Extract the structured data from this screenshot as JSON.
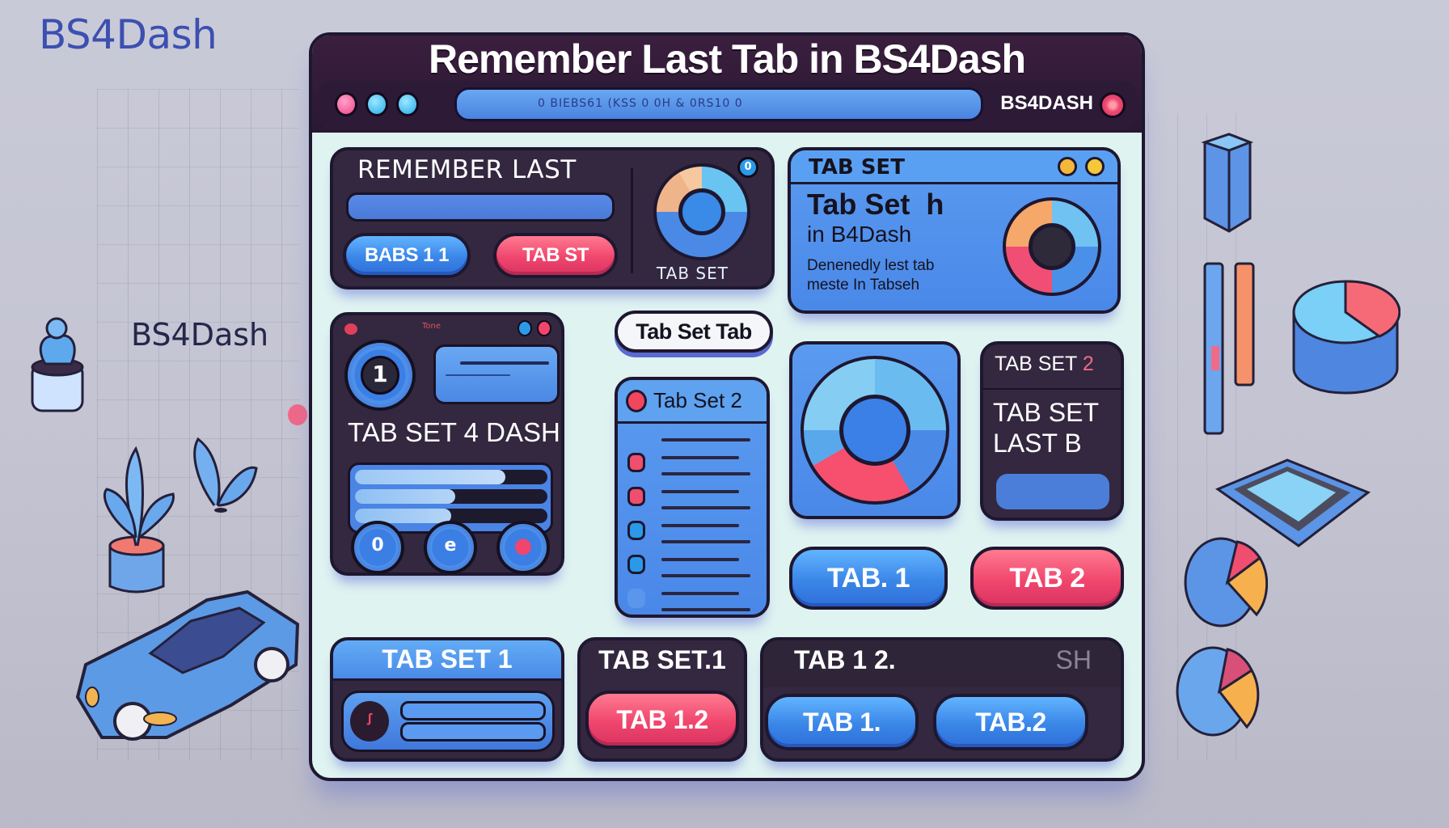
{
  "background": {
    "brand_top": "BS4Dash",
    "brand_side": "BS4Dash"
  },
  "window": {
    "title": "Remember Last Tab in BS4Dash",
    "toolbar": {
      "address_text": "0 BIEBS61 (KSS 0 0H & 0RS10 0",
      "brand": "BS4DASH"
    }
  },
  "cards": {
    "remember_last": {
      "title": "REMEMBER LAST",
      "button_blue": "BABS 1 1",
      "button_red": "TAB ST",
      "donut_label": "TAB SET",
      "badge": "0"
    },
    "tab_set_info": {
      "header": "TAB SET",
      "heading_line1": "Tab Set  h",
      "heading_line2": "in B4Dash",
      "desc_line1": "Denenedly lest tab",
      "desc_line2": "meste In Tabseh"
    },
    "tab_set_dash": {
      "header_text": "Tone",
      "number_badge": "1",
      "title": "TAB SET 4 DASH",
      "progress": [
        0.78,
        0.52,
        0.5
      ],
      "round_buttons": [
        "0",
        "e",
        "●"
      ]
    },
    "tab_set_tab_pill": "Tab Set Tab",
    "tab_set_2_list": {
      "header": "Tab Set 2",
      "items": 6
    },
    "tab_set_2_dark": {
      "header": "TAB SET",
      "header_num": "2",
      "line1": "TAB SET",
      "line2": "LAST B"
    },
    "tab_pills": {
      "tab1": "TAB. 1",
      "tab2": "TAB 2"
    },
    "bottom": {
      "set1_header": "TAB SET 1",
      "set1b_header": "TAB SET.1",
      "set1b_button": "TAB 1.2",
      "set12_header": "TAB 1 2.",
      "set12_header_suffix": "SH",
      "set12_btn1": "TAB 1.",
      "set12_btn2": "TAB.2"
    }
  },
  "colors": {
    "dark": "#33283f",
    "blue": "#4a88e8",
    "red": "#f0466e",
    "window_bg": "#dff3f1",
    "title_bar": "#2a1832"
  }
}
